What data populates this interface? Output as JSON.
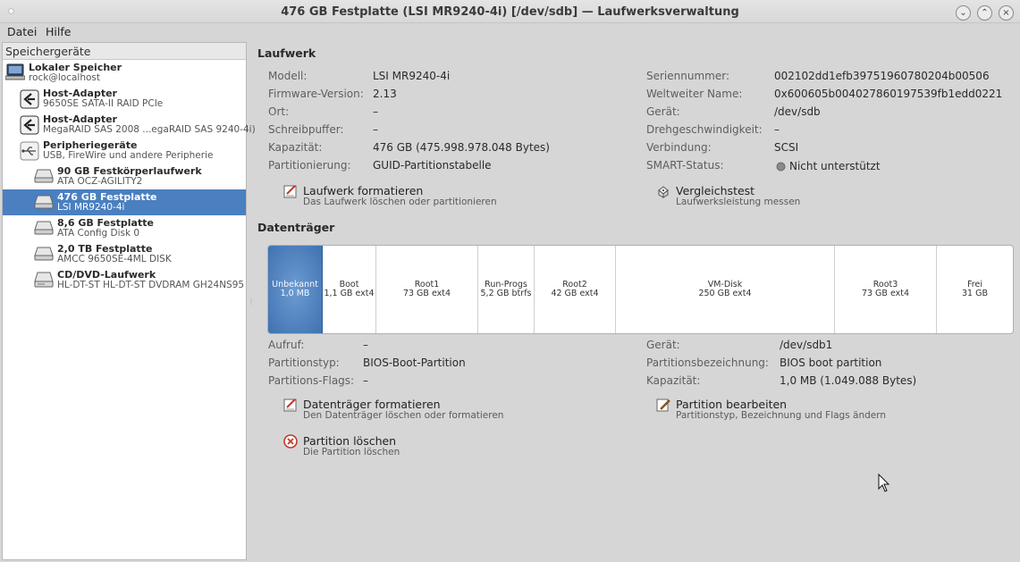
{
  "window": {
    "title": "476 GB Festplatte (LSI MR9240-4i) [/dev/sdb] — Laufwerksverwaltung",
    "minimize_glyph": "⌄",
    "maximize_glyph": "⌃",
    "close_glyph": "×"
  },
  "menu": {
    "datei": "Datei",
    "hilfe": "Hilfe"
  },
  "sidebar": {
    "header": "Speichergeräte",
    "items": [
      {
        "name": "Lokaler Speicher",
        "sub": "rock@localhost",
        "icon": "computer-icon"
      },
      {
        "name": "Host-Adapter",
        "sub": "9650SE SATA-II RAID PCIe",
        "icon": "host-adapter-icon"
      },
      {
        "name": "Host-Adapter",
        "sub": "MegaRAID SAS 2008 ...egaRAID SAS 9240-4i)",
        "icon": "host-adapter-icon"
      },
      {
        "name": "Peripheriegeräte",
        "sub": "USB, FireWire und andere Peripherie",
        "icon": "usb-icon"
      },
      {
        "name": "90 GB Festkörperlaufwerk",
        "sub": "ATA OCZ-AGILITY2",
        "icon": "drive-icon"
      },
      {
        "name": "476 GB Festplatte",
        "sub": "LSI MR9240-4i",
        "icon": "drive-icon"
      },
      {
        "name": "8,6 GB Festplatte",
        "sub": "ATA Config   Disk 0",
        "icon": "drive-icon"
      },
      {
        "name": "2,0 TB Festplatte",
        "sub": "AMCC 9650SE-4ML DISK",
        "icon": "drive-icon"
      },
      {
        "name": "CD/DVD-Laufwerk",
        "sub": "HL-DT-ST HL-DT-ST DVDRAM GH24NS95",
        "icon": "optical-drive-icon"
      }
    ]
  },
  "drive": {
    "section_title": "Laufwerk",
    "model_label": "Modell:",
    "model": "LSI MR9240-4i",
    "firmware_label": "Firmware-Version:",
    "firmware": "2.13",
    "location_label": "Ort:",
    "location": "–",
    "write_cache_label": "Schreibpuffer:",
    "write_cache": "–",
    "capacity_label": "Kapazität:",
    "capacity": "476 GB (475.998.978.048 Bytes)",
    "partitioning_label": "Partitionierung:",
    "partitioning": "GUID-Partitionstabelle",
    "serial_label": "Seriennummer:",
    "serial": "002102dd1efb39751960780204b00506",
    "wwn_label": "Weltweiter Name:",
    "wwn": "0x600605b004027860197539fb1edd0221",
    "device_label": "Gerät:",
    "device": "/dev/sdb",
    "rotation_label": "Drehgeschwindigkeit:",
    "rotation": "–",
    "connection_label": "Verbindung:",
    "connection": "SCSI",
    "smart_label": "SMART-Status:",
    "smart": "Nicht unterstützt",
    "format_title": "Laufwerk formatieren",
    "format_sub": "Das Laufwerk löschen oder partitionieren",
    "benchmark_title": "Vergleichstest",
    "benchmark_sub": "Laufwerksleistung messen"
  },
  "volumes": {
    "section_title": "Datenträger",
    "segments": [
      {
        "name": "Unbekannt",
        "detail": "1,0 MB"
      },
      {
        "name": "Boot",
        "detail": "1,1 GB ext4"
      },
      {
        "name": "Root1",
        "detail": "73 GB ext4"
      },
      {
        "name": "Run-Progs",
        "detail": "5,2 GB btrfs"
      },
      {
        "name": "Root2",
        "detail": "42 GB ext4"
      },
      {
        "name": "VM-Disk",
        "detail": "250 GB ext4"
      },
      {
        "name": "Root3",
        "detail": "73 GB ext4"
      },
      {
        "name": "Frei",
        "detail": "31 GB"
      }
    ],
    "usage_label": "Aufruf:",
    "usage": "–",
    "ptype_label": "Partitionstyp:",
    "ptype": "BIOS-Boot-Partition",
    "pflags_label": "Partitions-Flags:",
    "pflags": "–",
    "device_label": "Gerät:",
    "device": "/dev/sdb1",
    "plabel_label": "Partitionsbezeichnung:",
    "plabel": "BIOS boot partition",
    "capacity_label": "Kapazität:",
    "capacity": "1,0 MB (1.049.088 Bytes)",
    "format_title": "Datenträger formatieren",
    "format_sub": "Den Datenträger löschen oder formatieren",
    "edit_title": "Partition bearbeiten",
    "edit_sub": "Partitionstyp, Bezeichnung und Flags ändern",
    "delete_title": "Partition löschen",
    "delete_sub": "Die Partition löschen"
  }
}
